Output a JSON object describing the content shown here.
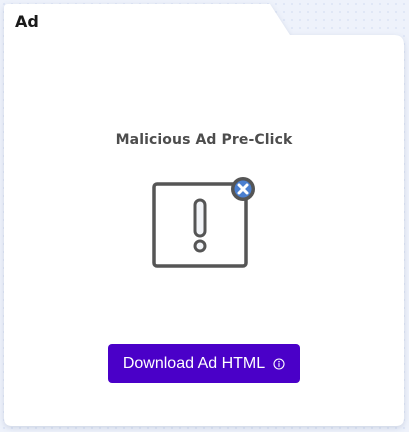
{
  "panel": {
    "tab_title": "Ad"
  },
  "ad": {
    "title": "Malicious Ad Pre-Click",
    "illustration_icon": "warning-window-icon",
    "close_badge_icon": "close-badge-icon"
  },
  "actions": {
    "download_label": "Download Ad HTML",
    "info_icon": "info-icon"
  },
  "colors": {
    "button_bg": "#4a00c8",
    "icon_stroke": "#555555",
    "badge_blue": "#4a7fd0",
    "badge_ring": "#555555"
  }
}
